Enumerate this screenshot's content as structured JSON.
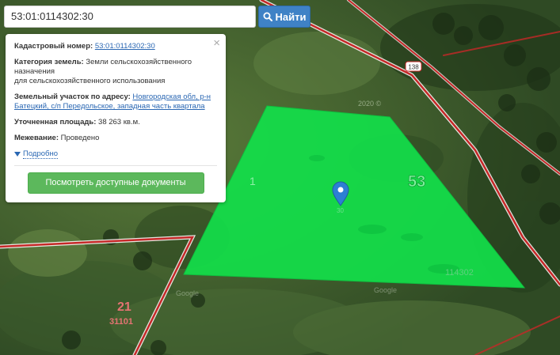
{
  "search": {
    "value": "53:01:0114302:30",
    "button_label": "Найти"
  },
  "popup": {
    "cadastral_label": "Кадастровый номер:",
    "cadastral_value": "53:01:0114302:30",
    "category_label": "Категория земель:",
    "category_value": "Земли сельскохозяйственного назначения",
    "category_value2": "для сельскохозяйственного использования",
    "address_label": "Земельный участок по адресу:",
    "address_value": "Новгородская обл, р-н Батецкий, с/п Передольское, западная часть квартала",
    "area_label": "Уточненная площадь:",
    "area_value": "38 263 кв.м.",
    "survey_label": "Межевание:",
    "survey_value": "Проведено",
    "details_label": "Подробно",
    "docs_button": "Посмотреть доступные документы",
    "close_glyph": "×"
  },
  "map": {
    "road_number": "138",
    "parcel_label_small": "1",
    "parcel_region": "53",
    "parcel_block": "114302",
    "parcel_marker_text": "30",
    "year_label": "2020 ©",
    "region_number": "21",
    "block_number": "31101",
    "watermark": "Google",
    "parcel_color": "#12e04a",
    "road_color": "#c62828",
    "marker_color": "#2d7fd4"
  }
}
